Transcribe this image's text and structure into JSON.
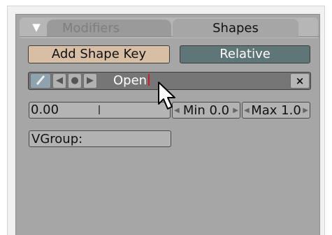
{
  "tabs": {
    "collapse_icon": "▼",
    "modifiers_label": "Modifiers",
    "shapes_label": "Shapes"
  },
  "shape_buttons": {
    "add_shape_key_label": "Add Shape Key",
    "relative_label": "Relative"
  },
  "shape_key": {
    "name_value": "Open",
    "close_label": "×",
    "nav_icons": [
      "pin-icon",
      "prev-arrow-icon",
      "dot-icon",
      "next-arrow-icon"
    ]
  },
  "value_row": {
    "slider_value": "0.00",
    "min_label": "Min 0.0",
    "max_label": "Max 1.0"
  },
  "vgroup": {
    "label": "VGroup:"
  },
  "colors": {
    "panel_bg": "#a6a6a6",
    "add_key_button": "#d8bea5",
    "relative_button": "#5f7678",
    "key_row_bg": "#767676",
    "text_cursor": "#cc2020"
  }
}
